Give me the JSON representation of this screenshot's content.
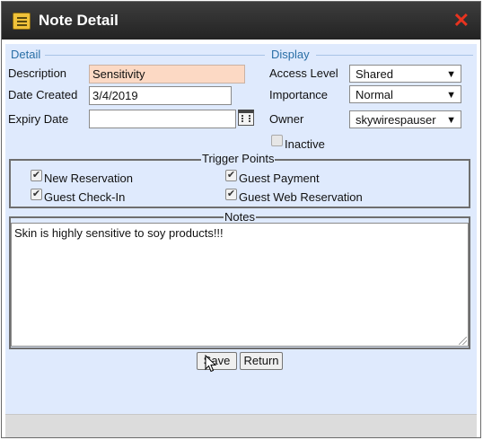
{
  "window": {
    "title": "Note Detail",
    "close_icon": "close-x-icon",
    "title_icon": "note-icon"
  },
  "detail": {
    "section_label": "Detail",
    "description_label": "Description",
    "description_value": "Sensitivity",
    "date_created_label": "Date Created",
    "date_created_value": "3/4/2019",
    "expiry_date_label": "Expiry Date",
    "expiry_date_value": "",
    "calendar_icon": "calendar-icon"
  },
  "display": {
    "section_label": "Display",
    "access_level_label": "Access Level",
    "access_level_value": "Shared",
    "importance_label": "Importance",
    "importance_value": "Normal",
    "owner_label": "Owner",
    "owner_value": "skywirespauser",
    "inactive_label": "Inactive",
    "inactive_checked": false
  },
  "trigger_points": {
    "legend": "Trigger Points",
    "items": [
      {
        "label": "New Reservation",
        "checked": true
      },
      {
        "label": "Guest Payment",
        "checked": true
      },
      {
        "label": "Guest Check-In",
        "checked": true
      },
      {
        "label": "Guest Web Reservation",
        "checked": true
      }
    ]
  },
  "notes": {
    "legend": "Notes",
    "value": "Skin is highly sensitive to soy products!!!"
  },
  "buttons": {
    "save_label": "Save",
    "return_label": "Return"
  },
  "colors": {
    "titlebar": "#2b2b2b",
    "content_bg": "#dfeafd",
    "close": "#e8331f",
    "section_label": "#2a6fa6",
    "highlight_field": "#fcd9c4"
  }
}
